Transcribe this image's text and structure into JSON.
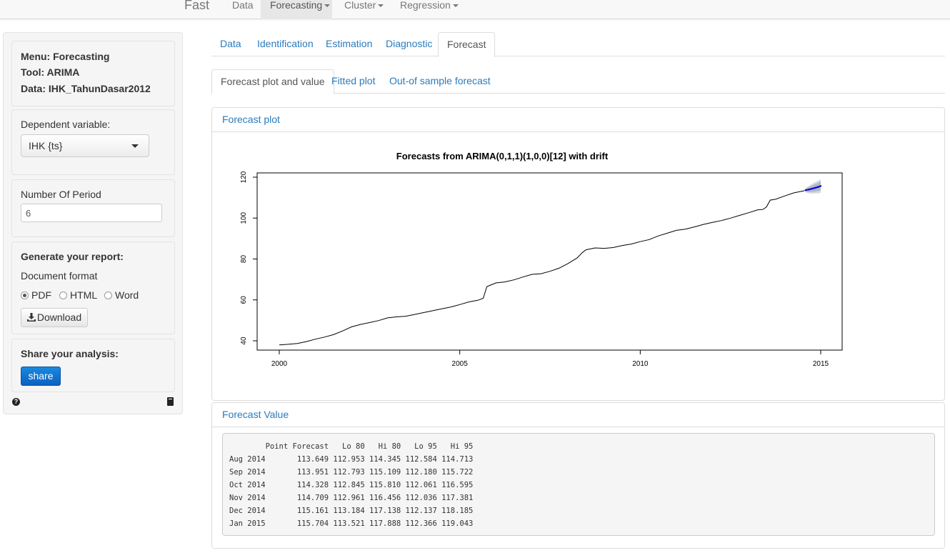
{
  "navbar": {
    "brand": "Fast",
    "items": [
      {
        "label": "Data",
        "dropdown": false,
        "active": false
      },
      {
        "label": "Forecasting",
        "dropdown": true,
        "active": true
      },
      {
        "label": "Cluster",
        "dropdown": true,
        "active": false
      },
      {
        "label": "Regression",
        "dropdown": true,
        "active": false
      }
    ]
  },
  "sidebar": {
    "menu": "Menu: Forecasting",
    "tool": "Tool: ARIMA",
    "data": "Data: IHK_TahunDasar2012",
    "dependent_label": "Dependent variable:",
    "dependent_value": "IHK {ts}",
    "period_label": "Number Of Period",
    "period_value": "6",
    "report_title": "Generate your report:",
    "format_label": "Document format",
    "formats": [
      {
        "label": "PDF",
        "checked": true
      },
      {
        "label": "HTML",
        "checked": false
      },
      {
        "label": "Word",
        "checked": false
      }
    ],
    "download_label": "Download",
    "share_title": "Share your analysis:",
    "share_label": "share",
    "help_icon": "question-circle-icon",
    "book_icon": "book-icon"
  },
  "tabs_main": [
    {
      "label": "Data",
      "active": false
    },
    {
      "label": "Identification",
      "active": false
    },
    {
      "label": "Estimation",
      "active": false
    },
    {
      "label": "Diagnostic",
      "active": false
    },
    {
      "label": "Forecast",
      "active": true
    }
  ],
  "tabs_sub": [
    {
      "label": "Forecast plot and value",
      "active": true
    },
    {
      "label": "Fitted plot",
      "active": false
    },
    {
      "label": "Out-of sample forecast",
      "active": false
    }
  ],
  "forecast_plot_title": "Forecast plot",
  "forecast_value_title": "Forecast Value",
  "forecast_table": {
    "columns": [
      "Point Forecast",
      "Lo 80",
      "Hi 80",
      "Lo 95",
      "Hi 95"
    ],
    "rows": [
      {
        "period": "Aug 2014",
        "values": [
          "113.649",
          "112.953",
          "114.345",
          "112.584",
          "114.713"
        ]
      },
      {
        "period": "Sep 2014",
        "values": [
          "113.951",
          "112.793",
          "115.109",
          "112.180",
          "115.722"
        ]
      },
      {
        "period": "Oct 2014",
        "values": [
          "114.328",
          "112.845",
          "115.810",
          "112.061",
          "116.595"
        ]
      },
      {
        "period": "Nov 2014",
        "values": [
          "114.709",
          "112.961",
          "116.456",
          "112.036",
          "117.381"
        ]
      },
      {
        "period": "Dec 2014",
        "values": [
          "115.161",
          "113.184",
          "117.138",
          "112.137",
          "118.185"
        ]
      },
      {
        "period": "Jan 2015",
        "values": [
          "115.704",
          "113.521",
          "117.888",
          "112.366",
          "119.043"
        ]
      }
    ]
  },
  "chart_data": {
    "type": "line",
    "title": "Forecasts from ARIMA(0,1,1)(1,0,0)[12] with drift",
    "xlabel": "",
    "ylabel": "",
    "xlim": [
      2000,
      2015
    ],
    "ylim": [
      40,
      120
    ],
    "xticks": [
      2000,
      2005,
      2010,
      2015
    ],
    "yticks": [
      40,
      60,
      80,
      100,
      120
    ],
    "grid": false,
    "colors": {
      "history": "#000000",
      "forecast": "#0000cc",
      "band80": "#b0b6cc",
      "band95": "#d6d8e0"
    },
    "series": [
      {
        "x": [
          2000.0,
          2000.25,
          2000.5,
          2000.75,
          2001.0,
          2001.25,
          2001.5,
          2001.75,
          2002.0,
          2002.25,
          2002.5,
          2002.75,
          2003.0,
          2003.25,
          2003.5,
          2003.75,
          2004.0,
          2004.25,
          2004.5,
          2004.75,
          2005.0,
          2005.25,
          2005.5,
          2005.65,
          2005.75,
          2005.85,
          2006.0,
          2006.25,
          2006.5,
          2006.75,
          2007.0,
          2007.25,
          2007.5,
          2007.75,
          2008.0,
          2008.25,
          2008.4,
          2008.5,
          2008.75,
          2009.0,
          2009.25,
          2009.5,
          2009.75,
          2010.0,
          2010.25,
          2010.5,
          2010.75,
          2011.0,
          2011.25,
          2011.5,
          2011.75,
          2012.0,
          2012.25,
          2012.5,
          2012.75,
          2013.0,
          2013.25,
          2013.4,
          2013.5,
          2013.6,
          2013.75,
          2014.0,
          2014.25,
          2014.55
        ],
        "values": [
          38.0,
          38.3,
          38.7,
          39.6,
          40.8,
          41.8,
          43.0,
          44.8,
          46.8,
          48.0,
          48.9,
          49.9,
          51.2,
          51.7,
          52.0,
          52.9,
          53.8,
          54.7,
          55.6,
          56.5,
          57.7,
          59.0,
          59.8,
          60.8,
          66.5,
          67.2,
          68.3,
          68.8,
          69.8,
          71.2,
          72.5,
          72.8,
          74.0,
          75.5,
          77.8,
          80.5,
          83.2,
          84.5,
          85.4,
          85.2,
          85.6,
          86.6,
          87.3,
          88.5,
          89.5,
          91.3,
          92.6,
          94.0,
          94.6,
          95.7,
          96.9,
          97.9,
          98.8,
          100.0,
          101.3,
          102.6,
          104.0,
          104.2,
          105.5,
          108.8,
          109.2,
          110.8,
          112.3,
          113.4
        ]
      },
      {
        "name": "forecast",
        "x": [
          2014.58,
          2014.67,
          2014.75,
          2014.83,
          2014.92,
          2015.0
        ],
        "values": [
          113.649,
          113.951,
          114.328,
          114.709,
          115.161,
          115.704
        ],
        "lo80": [
          112.953,
          112.793,
          112.845,
          112.961,
          113.184,
          113.521
        ],
        "hi80": [
          114.345,
          115.109,
          115.81,
          116.456,
          117.138,
          117.888
        ],
        "lo95": [
          112.584,
          112.18,
          112.061,
          112.036,
          112.137,
          112.366
        ],
        "hi95": [
          114.713,
          115.722,
          116.595,
          117.381,
          118.185,
          119.043
        ]
      }
    ]
  }
}
